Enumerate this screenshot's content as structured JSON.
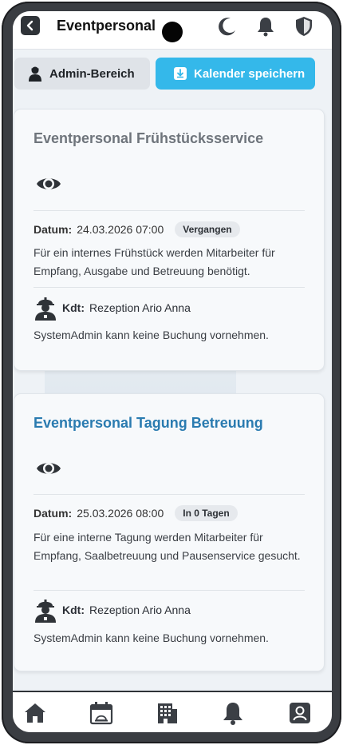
{
  "header": {
    "title": "Eventpersonal",
    "icons": [
      "back-icon",
      "moon-icon",
      "bell-icon",
      "shield-icon"
    ]
  },
  "actions": {
    "admin_label": "Admin-Bereich",
    "save_calendar_label": "Kalender speichern"
  },
  "events": [
    {
      "title": "Eventpersonal Frühstücksservice",
      "date_label": "Datum:",
      "date_value": "24.03.2026 07:00",
      "status": "Vergangen",
      "description": "Für ein internes Frühstück werden Mitarbeiter für Empfang, Ausgabe und Betreuung benötigt.",
      "kdt_label": "Kdt:",
      "kdt_value": "Rezeption Ario Anna",
      "note": "SystemAdmin kann keine Buchung vornehmen."
    },
    {
      "title": "Eventpersonal Tagung Betreuung",
      "date_label": "Datum:",
      "date_value": "25.03.2026 08:00",
      "status": "In 0 Tagen",
      "description": "Für eine interne Tagung werden Mitarbeiter für Empfang, Saalbetreuung und Pausenservice gesucht.",
      "kdt_label": "Kdt:",
      "kdt_value": "Rezeption Ario Anna",
      "note": "SystemAdmin kann keine Buchung vornehmen."
    }
  ],
  "bottom_nav": [
    "home-icon",
    "calendar-icon",
    "hotel-icon",
    "bell-icon",
    "user-icon"
  ],
  "colors": {
    "accent": "#34b8ea",
    "title_active": "#2a7bb0",
    "title_past": "#6f757c"
  }
}
